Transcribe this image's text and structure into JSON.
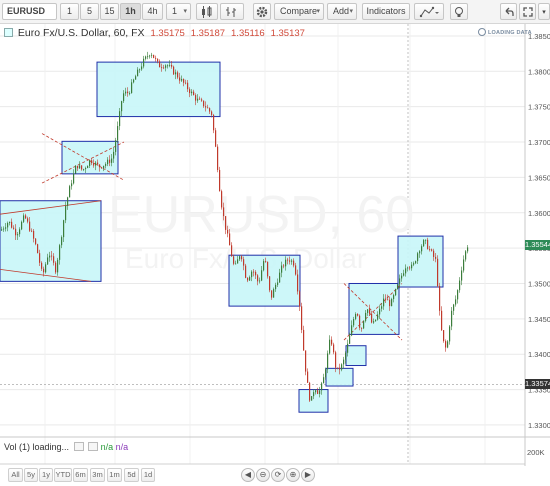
{
  "toolbar": {
    "symbol": "EURUSD",
    "intervals": [
      "1",
      "5",
      "15",
      "1h",
      "4h",
      "1"
    ],
    "active_interval": "1h",
    "compare_label": "Compare",
    "add_label": "Add",
    "indicators_label": "Indicators"
  },
  "legend": {
    "title": "Euro Fx/U.S. Dollar, 60, FX",
    "open": "1.35175",
    "high": "1.35187",
    "low": "1.35116",
    "close": "1.35137"
  },
  "branding": {
    "loading": "LOADING DATA"
  },
  "watermark": {
    "symbol": "EURUSD, 60",
    "description": "Euro Fx/U.S. Dollar"
  },
  "volume_pane": {
    "label": "Vol (1) loading...",
    "value1": "n/a",
    "value2": "n/a",
    "axis_label": "200K"
  },
  "price_tags": {
    "last": "1.35544",
    "cross": "1.33574"
  },
  "range_buttons": [
    "All",
    "5y",
    "1y",
    "YTD",
    "6m",
    "3m",
    "1m",
    "5d",
    "1d"
  ],
  "nav_buttons": [
    "◀",
    "⊖",
    "⟳",
    "⊕",
    "▶"
  ],
  "colors": {
    "bull": "#3b7d3b",
    "bear": "#c0392b",
    "box_fill": "#c8f6f8",
    "box_stroke": "#1f2fa8",
    "grid": "#e9e9e9",
    "last_tag": "#2e8b57",
    "cross_tag": "#333333"
  },
  "chart_data": {
    "type": "candlestick",
    "price_axis": [
      "1.38500",
      "1.38000",
      "1.37500",
      "1.37000",
      "1.36500",
      "1.36000",
      "1.35500",
      "1.35000",
      "1.34500",
      "1.34000",
      "1.33500",
      "1.33000"
    ],
    "price_range": [
      1.329,
      1.3857
    ],
    "close_path": [
      [
        0,
        1.3575
      ],
      [
        8,
        1.3588
      ],
      [
        16,
        1.357
      ],
      [
        24,
        1.3595
      ],
      [
        30,
        1.3575
      ],
      [
        36,
        1.355
      ],
      [
        42,
        1.351
      ],
      [
        48,
        1.3545
      ],
      [
        55,
        1.352
      ],
      [
        60,
        1.356
      ],
      [
        65,
        1.361
      ],
      [
        70,
        1.364
      ],
      [
        76,
        1.3668
      ],
      [
        82,
        1.366
      ],
      [
        90,
        1.3675
      ],
      [
        98,
        1.3665
      ],
      [
        106,
        1.367
      ],
      [
        112,
        1.3678
      ],
      [
        117,
        1.372
      ],
      [
        122,
        1.3768
      ],
      [
        128,
        1.377
      ],
      [
        134,
        1.379
      ],
      [
        142,
        1.3812
      ],
      [
        150,
        1.3828
      ],
      [
        158,
        1.3808
      ],
      [
        166,
        1.381
      ],
      [
        176,
        1.3795
      ],
      [
        186,
        1.3778
      ],
      [
        196,
        1.376
      ],
      [
        204,
        1.3752
      ],
      [
        211,
        1.374
      ],
      [
        216,
        1.368
      ],
      [
        220,
        1.362
      ],
      [
        224,
        1.3585
      ],
      [
        228,
        1.356
      ],
      [
        234,
        1.352
      ],
      [
        240,
        1.3545
      ],
      [
        246,
        1.3505
      ],
      [
        252,
        1.352
      ],
      [
        258,
        1.35
      ],
      [
        264,
        1.3538
      ],
      [
        270,
        1.3478
      ],
      [
        276,
        1.3502
      ],
      [
        282,
        1.3525
      ],
      [
        288,
        1.3535
      ],
      [
        294,
        1.3528
      ],
      [
        299,
        1.347
      ],
      [
        302,
        1.342
      ],
      [
        306,
        1.3365
      ],
      [
        310,
        1.333
      ],
      [
        314,
        1.3355
      ],
      [
        318,
        1.3345
      ],
      [
        322,
        1.3358
      ],
      [
        326,
        1.339
      ],
      [
        330,
        1.3425
      ],
      [
        336,
        1.3375
      ],
      [
        342,
        1.3385
      ],
      [
        348,
        1.3418
      ],
      [
        352,
        1.3445
      ],
      [
        356,
        1.3465
      ],
      [
        360,
        1.3432
      ],
      [
        366,
        1.3468
      ],
      [
        372,
        1.344
      ],
      [
        378,
        1.3458
      ],
      [
        384,
        1.348
      ],
      [
        390,
        1.347
      ],
      [
        396,
        1.3492
      ],
      [
        400,
        1.3508
      ],
      [
        406,
        1.3528
      ],
      [
        412,
        1.3522
      ],
      [
        418,
        1.3548
      ],
      [
        424,
        1.356
      ],
      [
        430,
        1.3545
      ],
      [
        436,
        1.353
      ],
      [
        438,
        1.347
      ],
      [
        442,
        1.342
      ],
      [
        446,
        1.3405
      ],
      [
        450,
        1.3455
      ],
      [
        456,
        1.3482
      ],
      [
        462,
        1.353
      ],
      [
        467,
        1.3554
      ]
    ]
  }
}
